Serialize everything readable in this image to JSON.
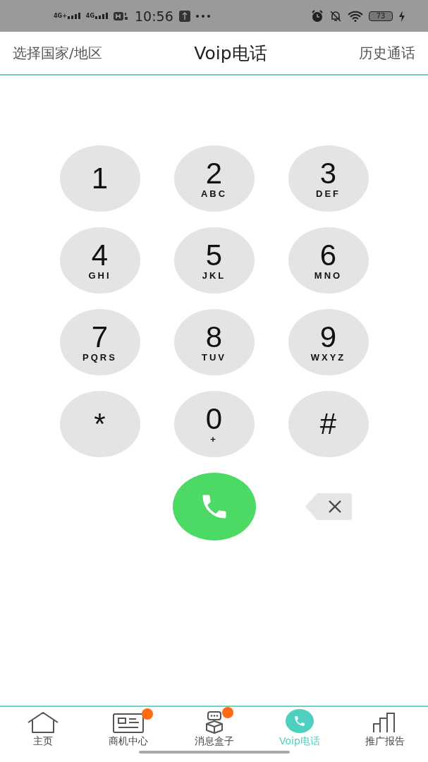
{
  "status_bar": {
    "networks": [
      "4G+",
      "4G"
    ],
    "time": "10:56",
    "battery": "73"
  },
  "header": {
    "left": "选择国家/地区",
    "title": "Voip电话",
    "right": "历史通话"
  },
  "keys": [
    {
      "digit": "1"
    },
    {
      "digit": "2",
      "letters": "ABC"
    },
    {
      "digit": "3",
      "letters": "DEF"
    },
    {
      "digit": "4",
      "letters": "GHI"
    },
    {
      "digit": "5",
      "letters": "JKL"
    },
    {
      "digit": "6",
      "letters": "MNO"
    },
    {
      "digit": "7",
      "letters": "PQRS"
    },
    {
      "digit": "8",
      "letters": "TUV"
    },
    {
      "digit": "9",
      "letters": "WXYZ"
    },
    {
      "digit": "*"
    },
    {
      "digit": "0",
      "letters": "+"
    },
    {
      "digit": "#"
    }
  ],
  "nav": [
    {
      "kind": "home",
      "label": "主页",
      "selected": false,
      "badge": false
    },
    {
      "kind": "card",
      "label": "商机中心",
      "selected": false,
      "badge": true
    },
    {
      "kind": "box",
      "label": "消息盒子",
      "selected": false,
      "badge": true
    },
    {
      "kind": "phone",
      "label": "Voip电话",
      "selected": true,
      "badge": false
    },
    {
      "kind": "chart",
      "label": "推广报告",
      "selected": false,
      "badge": false
    }
  ]
}
